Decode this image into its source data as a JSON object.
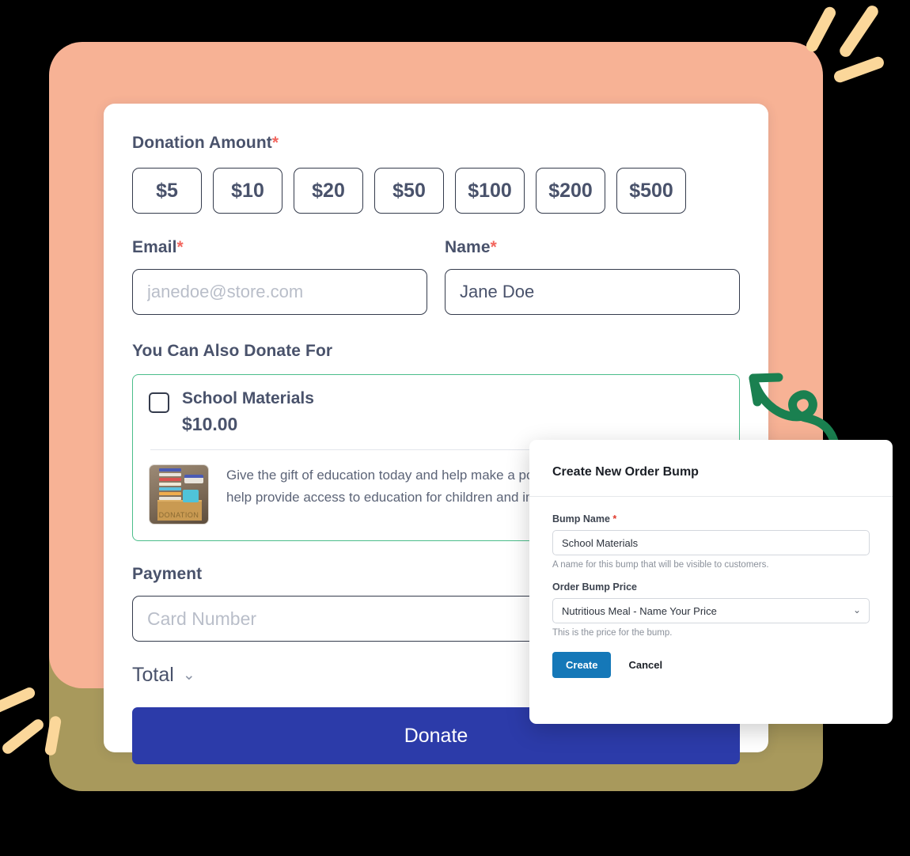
{
  "checkout": {
    "donation_amount_label": "Donation Amount",
    "required_mark": "*",
    "amounts": [
      "$5",
      "$10",
      "$20",
      "$50",
      "$100",
      "$200",
      "$500"
    ],
    "email_label": "Email",
    "email_placeholder": "janedoe@store.com",
    "email_value": "",
    "name_label": "Name",
    "name_value": "Jane Doe",
    "name_placeholder": "",
    "also_donate_label": "You Can Also Donate For",
    "bump": {
      "title": "School Materials",
      "price": "$10.00",
      "description": "Give the gift of education today and help make a positive impact. Your donation can help provide access to education for children and improve their future prospects.",
      "image_caption": "DONATION",
      "image_name": "donation-box-school-supplies"
    },
    "payment_label": "Payment",
    "card_placeholder": "Card Number",
    "card_value": "",
    "total_label": "Total",
    "total_chevron": "⌄",
    "donate_label": "Donate"
  },
  "modal": {
    "title": "Create New Order Bump",
    "bump_name_label": "Bump Name",
    "bump_name_required": "*",
    "bump_name_value": "School Materials",
    "bump_name_help": "A name for this bump that will be visible to customers.",
    "price_label": "Order Bump Price",
    "price_selected": "Nutritious Meal -  Name Your Price",
    "price_options": [
      "Nutritious Meal -  Name Your Price"
    ],
    "price_help": "This is the price for the bump.",
    "create_label": "Create",
    "cancel_label": "Cancel",
    "caret_icon": "⌄"
  },
  "colors": {
    "peach_panel": "#f7b295",
    "olive_panel": "#a8995c",
    "accent_stroke": "#fbd79a",
    "bump_border_green": "#4bbd8a",
    "arrow_green": "#1a8050",
    "donate_blue": "#2c3ba9",
    "create_blue": "#1578b8",
    "required_red": "#f2665e",
    "text_slate": "#49526b"
  }
}
